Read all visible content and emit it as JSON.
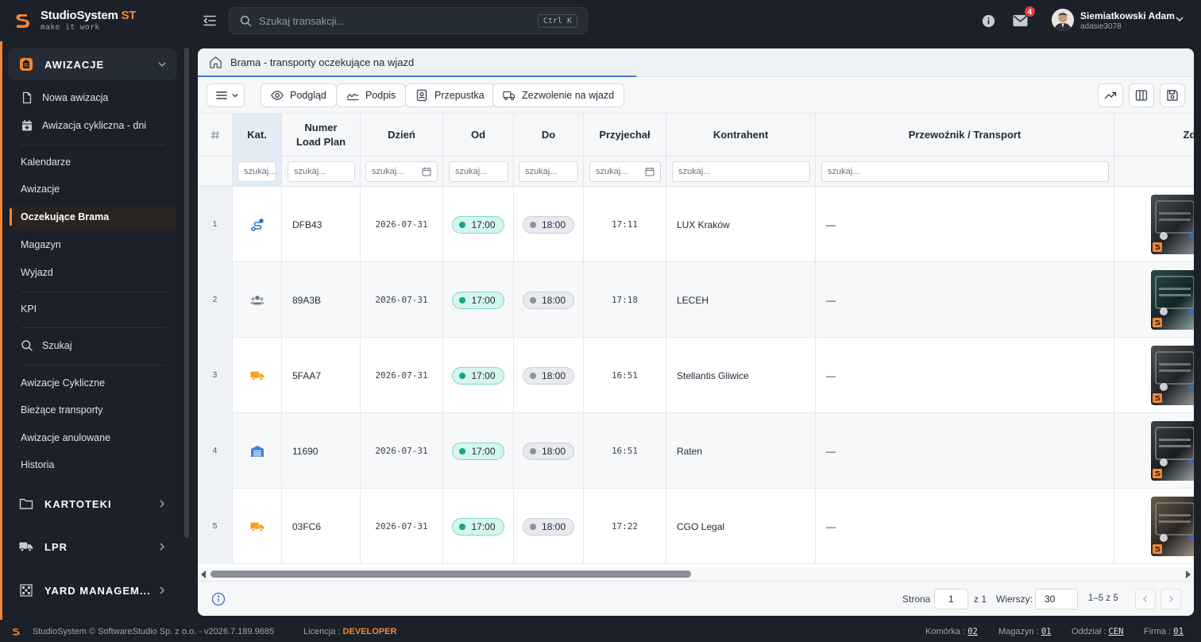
{
  "app": {
    "brand_name": "StudioSystem",
    "brand_suffix": "ST",
    "brand_tagline": "make it work",
    "accent_color": "#f58634"
  },
  "topbar": {
    "search_placeholder": "Szukaj transakcji...",
    "search_shortcut": "Ctrl K",
    "mail_count": "4",
    "user_name": "Siemiatkowski Adam",
    "user_login": "adasie3078"
  },
  "sidebar": {
    "awizacje_label": "AWIZACJE",
    "items": [
      {
        "label": "Nowa awizacja",
        "icon": "file-icon"
      },
      {
        "label": "Awizacja cykliczna - dni",
        "icon": "calendar-plus-icon"
      },
      {
        "label": "Kalendarze"
      },
      {
        "label": "Awizacje"
      },
      {
        "label": "Oczekujące Brama"
      },
      {
        "label": "Magazyn"
      },
      {
        "label": "Wyjazd"
      },
      {
        "label": "KPI"
      },
      {
        "label": "Szukaj",
        "icon": "search-icon"
      },
      {
        "label": "Awizacje Cykliczne"
      },
      {
        "label": "Bieżące transporty"
      },
      {
        "label": "Awizacje anulowane"
      },
      {
        "label": "Historia"
      }
    ],
    "kartoteki_label": "KARTOTEKI",
    "lpr_label": "LPR",
    "yard_label": "YARD MANAGEM..."
  },
  "main": {
    "tab_title": "Brama - transporty oczekujące na wjazd",
    "toolbar": {
      "preview_label": "Podgląd",
      "sign_label": "Podpis",
      "pass_label": "Przepustka",
      "entry_label": "Zezwolenie na wjazd"
    },
    "columns": {
      "index": "#",
      "kat": "Kat.",
      "load_plan_1": "Numer",
      "load_plan_2": "Load Plan",
      "day": "Dzień",
      "from": "Od",
      "to": "Do",
      "arrived": "Przyjechał",
      "contractor": "Kontrahent",
      "carrier": "Przewoźnik / Transport",
      "photo": "Zdj"
    },
    "filters": {
      "kat": "szukaj...",
      "generic": "szukaj..."
    },
    "rows": [
      {
        "idx": "1",
        "kat_icon": "route-icon",
        "load_plan": "DFB43",
        "day": "2026-07-31",
        "from": "17:00",
        "to": "18:00",
        "arrived": "17:11",
        "contractor": "LUX Kraków",
        "carrier": "—"
      },
      {
        "idx": "2",
        "kat_icon": "users-icon",
        "load_plan": "89A3B",
        "day": "2026-07-31",
        "from": "17:00",
        "to": "18:00",
        "arrived": "17:18",
        "contractor": "LECEH",
        "carrier": "—"
      },
      {
        "idx": "3",
        "kat_icon": "truck-icon",
        "load_plan": "5FAA7",
        "day": "2026-07-31",
        "from": "17:00",
        "to": "18:00",
        "arrived": "16:51",
        "contractor": "Stellantis Gliwice",
        "carrier": "—"
      },
      {
        "idx": "4",
        "kat_icon": "warehouse-icon",
        "load_plan": "11690",
        "day": "2026-07-31",
        "from": "17:00",
        "to": "18:00",
        "arrived": "16:51",
        "contractor": "Raten",
        "carrier": "—"
      },
      {
        "idx": "5",
        "kat_icon": "truck-icon",
        "load_plan": "03FC6",
        "day": "2026-07-31",
        "from": "17:00",
        "to": "18:00",
        "arrived": "17:22",
        "contractor": "CGO Legal",
        "carrier": "—"
      }
    ],
    "footer": {
      "page_label": "Strona",
      "page_value": "1",
      "page_of": "z 1",
      "rows_label": "Wierszy:",
      "rows_value": "30",
      "range": "1–5 z 5"
    }
  },
  "statusbar": {
    "copyright": "StudioSystem © SoftwareStudio Sp. z o.o. - v2026.7.189.9685",
    "license_label": "Licencja :",
    "license_value": "DEVELOPER",
    "cell_label": "Komórka :",
    "cell_value": "02",
    "warehouse_label": "Magazyn :",
    "warehouse_value": "01",
    "branch_label": "Oddział :",
    "branch_value": "CEN",
    "company_label": "Firma :",
    "company_value": "01"
  }
}
